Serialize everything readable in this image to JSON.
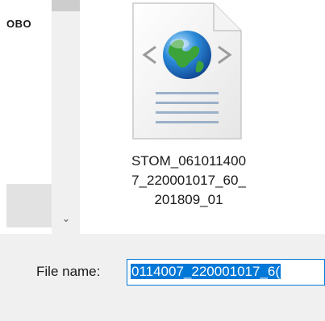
{
  "nav": {
    "partial_label": "OBO"
  },
  "file": {
    "name_lines": [
      "STOM_061011400",
      "7_220001017_60_",
      "201809_01"
    ]
  },
  "save_bar": {
    "filename_label": "File name:",
    "filename_value": "0114007_220001017_6("
  },
  "colors": {
    "accent": "#0078d7",
    "bar_bg": "#f0f0f0"
  },
  "icons": {
    "file": "web-document-globe-icon",
    "scroll_down": "chevron-down-icon"
  }
}
